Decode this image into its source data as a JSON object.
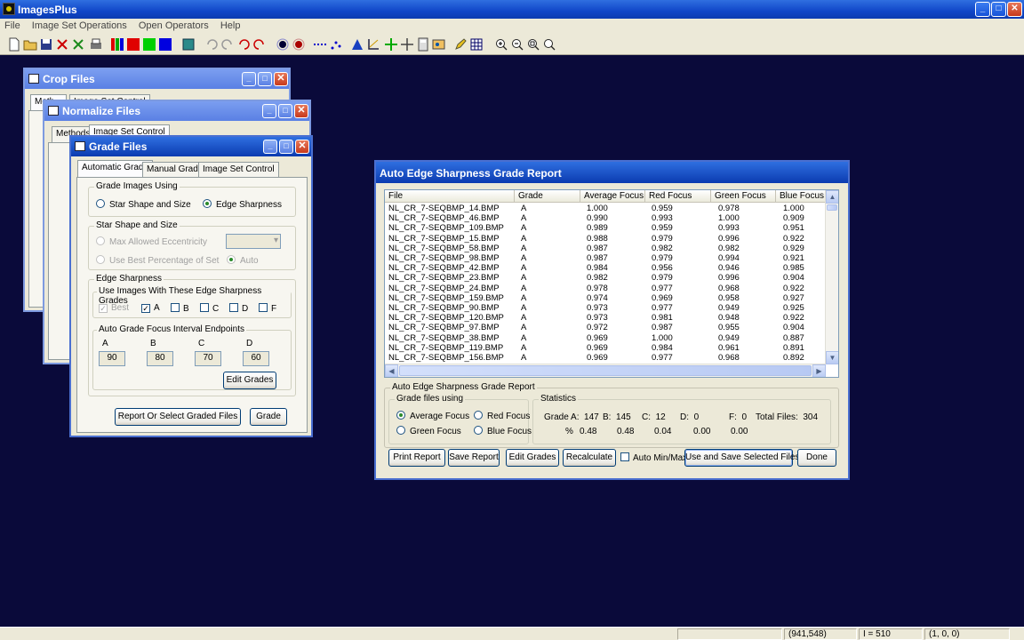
{
  "app": {
    "title": "ImagesPlus",
    "menu": [
      "File",
      "Image Set Operations",
      "Open Operators",
      "Help"
    ]
  },
  "status": {
    "coords": "(941,548)",
    "intensity": "I = 510",
    "rgb": "(1, 0, 0)"
  },
  "crop_window": {
    "title": "Crop Files",
    "tabs": [
      "Meth...",
      "Image Set Control"
    ]
  },
  "normalize_window": {
    "title": "Normalize Files",
    "tabs": [
      "Methods",
      "Image Set Control"
    ]
  },
  "grade_window": {
    "title": "Grade Files",
    "tabs": [
      "Automatic Grade",
      "Manual Grade",
      "Image Set Control"
    ],
    "grade_using": {
      "label": "Grade Images Using",
      "options": [
        "Star Shape and Size",
        "Edge Sharpness"
      ],
      "selected": "Edge Sharpness"
    },
    "star_shape": {
      "label": "Star Shape and Size",
      "max_ecc": "Max Allowed Eccentricity",
      "best_pct": "Use Best Percentage of Set",
      "auto": "Auto"
    },
    "edge": {
      "label": "Edge Sharpness",
      "grades_label": "Use Images With These Edge Sharpness Grades",
      "grades": [
        {
          "name": "Best",
          "checked": true,
          "disabled": true
        },
        {
          "name": "A",
          "checked": true,
          "disabled": false
        },
        {
          "name": "B",
          "checked": false,
          "disabled": false
        },
        {
          "name": "C",
          "checked": false,
          "disabled": false
        },
        {
          "name": "D",
          "checked": false,
          "disabled": false
        },
        {
          "name": "F",
          "checked": false,
          "disabled": false
        }
      ],
      "interval_label": "Auto Grade Focus  Interval Endpoints",
      "endpoints": [
        {
          "grade": "A",
          "value": "90"
        },
        {
          "grade": "B",
          "value": "80"
        },
        {
          "grade": "C",
          "value": "70"
        },
        {
          "grade": "D",
          "value": "60"
        }
      ],
      "edit_grades": "Edit Grades"
    },
    "report_button": "Report Or Select Graded Files",
    "grade_button": "Grade"
  },
  "report_window": {
    "title": "Auto Edge Sharpness Grade Report",
    "columns": [
      "File",
      "Grade",
      "Average Focus",
      "Red Focus",
      "Green Focus",
      "Blue Focus"
    ],
    "rows": [
      [
        "NL_CR_7-SEQBMP_14.BMP",
        "A",
        "1.000",
        "0.959",
        "0.978",
        "1.000"
      ],
      [
        "NL_CR_7-SEQBMP_46.BMP",
        "A",
        "0.990",
        "0.993",
        "1.000",
        "0.909"
      ],
      [
        "NL_CR_7-SEQBMP_109.BMP",
        "A",
        "0.989",
        "0.959",
        "0.993",
        "0.951"
      ],
      [
        "NL_CR_7-SEQBMP_15.BMP",
        "A",
        "0.988",
        "0.979",
        "0.996",
        "0.922"
      ],
      [
        "NL_CR_7-SEQBMP_58.BMP",
        "A",
        "0.987",
        "0.982",
        "0.982",
        "0.929"
      ],
      [
        "NL_CR_7-SEQBMP_98.BMP",
        "A",
        "0.987",
        "0.979",
        "0.994",
        "0.921"
      ],
      [
        "NL_CR_7-SEQBMP_42.BMP",
        "A",
        "0.984",
        "0.956",
        "0.946",
        "0.985"
      ],
      [
        "NL_CR_7-SEQBMP_23.BMP",
        "A",
        "0.982",
        "0.979",
        "0.996",
        "0.904"
      ],
      [
        "NL_CR_7-SEQBMP_24.BMP",
        "A",
        "0.978",
        "0.977",
        "0.968",
        "0.922"
      ],
      [
        "NL_CR_7-SEQBMP_159.BMP",
        "A",
        "0.974",
        "0.969",
        "0.958",
        "0.927"
      ],
      [
        "NL_CR_7-SEQBMP_90.BMP",
        "A",
        "0.973",
        "0.977",
        "0.949",
        "0.925"
      ],
      [
        "NL_CR_7-SEQBMP_120.BMP",
        "A",
        "0.973",
        "0.981",
        "0.948",
        "0.922"
      ],
      [
        "NL_CR_7-SEQBMP_97.BMP",
        "A",
        "0.972",
        "0.987",
        "0.955",
        "0.904"
      ],
      [
        "NL_CR_7-SEQBMP_38.BMP",
        "A",
        "0.969",
        "1.000",
        "0.949",
        "0.887"
      ],
      [
        "NL_CR_7-SEQBMP_119.BMP",
        "A",
        "0.969",
        "0.984",
        "0.961",
        "0.891"
      ],
      [
        "NL_CR_7-SEQBMP_156.BMP",
        "A",
        "0.969",
        "0.977",
        "0.968",
        "0.892"
      ]
    ],
    "summary_label": "Auto Edge Sharpness Grade Report",
    "grade_using_label": "Grade files using",
    "grade_using_options": [
      "Average Focus",
      "Red Focus",
      "Green Focus",
      "Blue Focus"
    ],
    "grade_using_selected": "Average Focus",
    "stats_label": "Statistics",
    "stats": {
      "counts": [
        {
          "label": "Grade A:",
          "value": "147"
        },
        {
          "label": "B:",
          "value": "145"
        },
        {
          "label": "C:",
          "value": "12"
        },
        {
          "label": "D:",
          "value": "0"
        },
        {
          "label": "F:",
          "value": "0"
        }
      ],
      "total_label": "Total Files:",
      "total": "304",
      "pct_label": "%",
      "pcts": [
        "0.48",
        "0.48",
        "0.04",
        "0.00",
        "0.00"
      ]
    },
    "buttons": {
      "print": "Print Report",
      "save": "Save Report",
      "edit": "Edit Grades",
      "recalc": "Recalculate",
      "auto_minmax": "Auto Min/Max",
      "use_save": "Use and Save Selected Files",
      "done": "Done"
    }
  }
}
